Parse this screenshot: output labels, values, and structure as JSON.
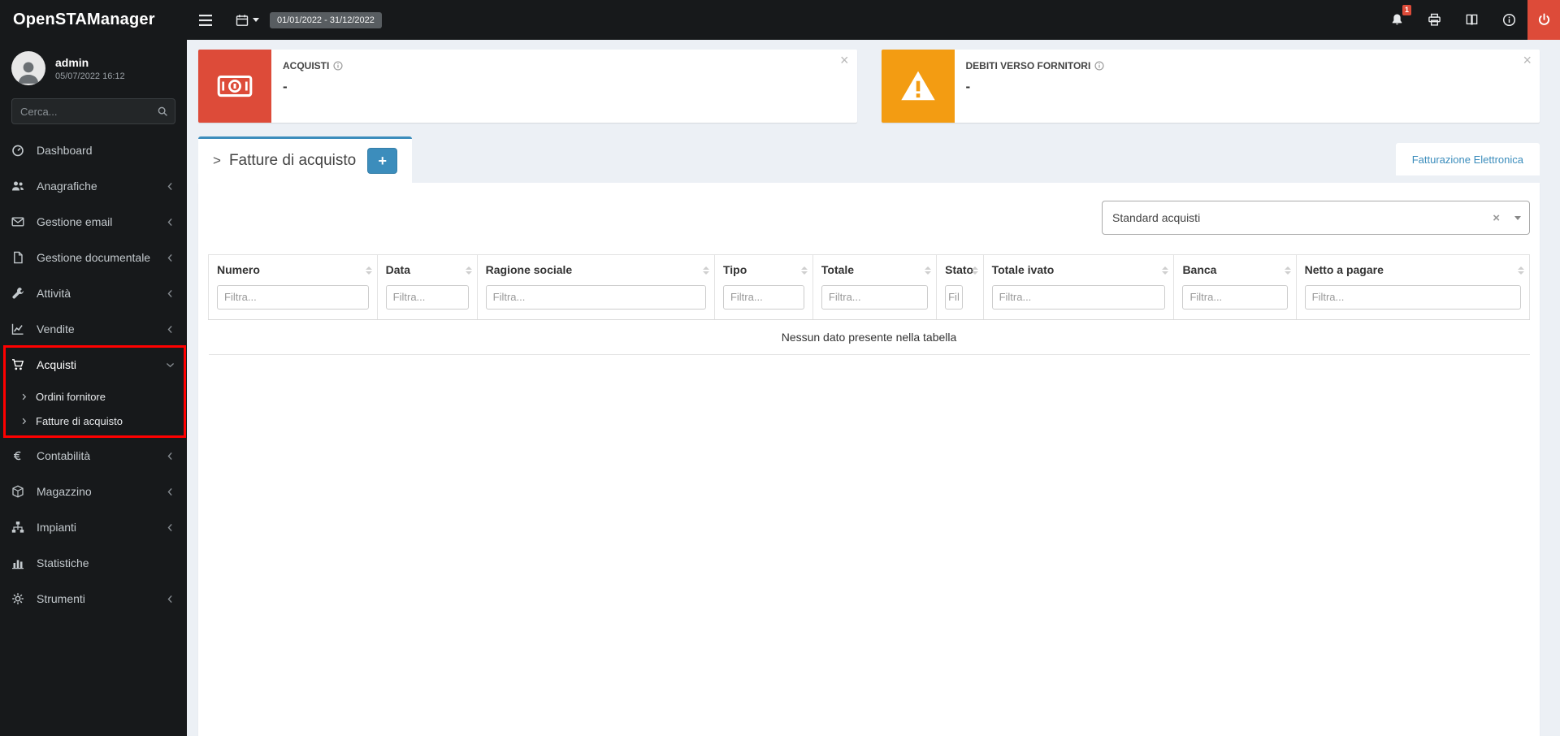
{
  "colors": {
    "accent": "#3c8dbc",
    "danger": "#dd4b39",
    "warning": "#f39c12",
    "annotation": "#ff0000"
  },
  "ui": {
    "close": "×",
    "clear": "×"
  },
  "topbar": {
    "brand": "OpenSTAManager",
    "date_range": "01/01/2022 - 31/12/2022",
    "notification_count": "1"
  },
  "sidebar": {
    "user": {
      "name": "admin",
      "datetime": "05/07/2022 16:12"
    },
    "search_placeholder": "Cerca...",
    "items": [
      {
        "id": "dashboard",
        "label": "Dashboard",
        "icon": "dashboard-icon",
        "expandable": false
      },
      {
        "id": "anagrafiche",
        "label": "Anagrafiche",
        "icon": "users-icon",
        "expandable": true
      },
      {
        "id": "gestione-email",
        "label": "Gestione email",
        "icon": "envelope-icon",
        "expandable": true
      },
      {
        "id": "gestione-documentale",
        "label": "Gestione documentale",
        "icon": "file-icon",
        "expandable": true
      },
      {
        "id": "attivita",
        "label": "Attività",
        "icon": "wrench-icon",
        "expandable": true
      },
      {
        "id": "vendite",
        "label": "Vendite",
        "icon": "chart-line-icon",
        "expandable": true
      },
      {
        "id": "acquisti",
        "label": "Acquisti",
        "icon": "cart-icon",
        "expandable": true,
        "expanded": true,
        "annotated": true,
        "children": [
          {
            "id": "ordini-fornitore",
            "label": "Ordini fornitore"
          },
          {
            "id": "fatture-di-acquisto",
            "label": "Fatture di acquisto",
            "active": true
          }
        ]
      },
      {
        "id": "contabilita",
        "label": "Contabilità",
        "icon": "euro-icon",
        "expandable": true
      },
      {
        "id": "magazzino",
        "label": "Magazzino",
        "icon": "cube-icon",
        "expandable": true
      },
      {
        "id": "impianti",
        "label": "Impianti",
        "icon": "sitemap-icon",
        "expandable": true
      },
      {
        "id": "statistiche",
        "label": "Statistiche",
        "icon": "bar-chart-icon",
        "expandable": false
      },
      {
        "id": "strumenti",
        "label": "Strumenti",
        "icon": "gear-icon",
        "expandable": true
      }
    ]
  },
  "widgets": [
    {
      "title": "ACQUISTI",
      "value": "-",
      "color": "#dd4b39",
      "icon": "money-icon"
    },
    {
      "title": "DEBITI VERSO FORNITORI",
      "value": "-",
      "color": "#f39c12",
      "icon": "warning-icon"
    }
  ],
  "main": {
    "tab_prefix": ">",
    "tab_title": "Fatture di acquisto",
    "add_button": "+",
    "link_right": "Fatturazione Elettronica",
    "filter_select": {
      "value": "Standard acquisti"
    },
    "table": {
      "columns": [
        "Numero",
        "Data",
        "Ragione sociale",
        "Tipo",
        "Totale",
        "Stato",
        "Totale ivato",
        "Banca",
        "Netto a pagare"
      ],
      "filter_placeholder": "Filtra...",
      "empty_text": "Nessun dato presente nella tabella"
    }
  }
}
